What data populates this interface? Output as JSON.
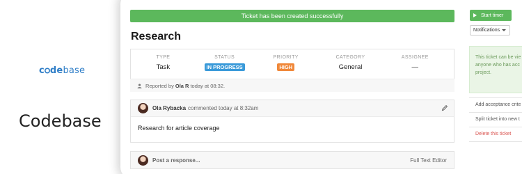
{
  "brand": {
    "logo_prefix": "c",
    "logo_mid": "de",
    "logo_suffix": "base",
    "title": "Codebase"
  },
  "banner": {
    "text": "Ticket has been created successfully"
  },
  "ticket": {
    "title": "Research",
    "fields": [
      {
        "label": "TYPE",
        "value": "Task"
      },
      {
        "label": "STATUS",
        "value": "IN PROGRESS"
      },
      {
        "label": "PRIORITY",
        "value": "HIGH"
      },
      {
        "label": "CATEGORY",
        "value": "General"
      },
      {
        "label": "ASSIGNEE",
        "value": "—"
      }
    ],
    "reported_prefix": "Reported by",
    "reported_user": "Ola R",
    "reported_suffix": "today at 08:32."
  },
  "comment": {
    "author": "Ola Rybacka",
    "meta": "commented today at 8:32am",
    "body": "Research for article coverage"
  },
  "response": {
    "placeholder": "Post a response...",
    "editor_link": "Full Text Editor"
  },
  "sidebar": {
    "timer_label": "Start timer",
    "notifications_label": "Notifications",
    "note_lines": [
      "This ticket can be vie",
      "anyone who has acc",
      "project."
    ],
    "actions": [
      {
        "label": "Add acceptance crite"
      },
      {
        "label": "Split ticket into new t"
      },
      {
        "label": "Delete this ticket"
      }
    ]
  },
  "colors": {
    "success": "#5cb85c",
    "status_badge": "#3a9ad9",
    "priority_badge": "#f0883a",
    "brand_blue": "#2f7ec7",
    "danger": "#d9534f"
  },
  "icons": [
    "person-icon",
    "pencil-icon",
    "play-icon",
    "caret-down-icon",
    "avatar"
  ]
}
